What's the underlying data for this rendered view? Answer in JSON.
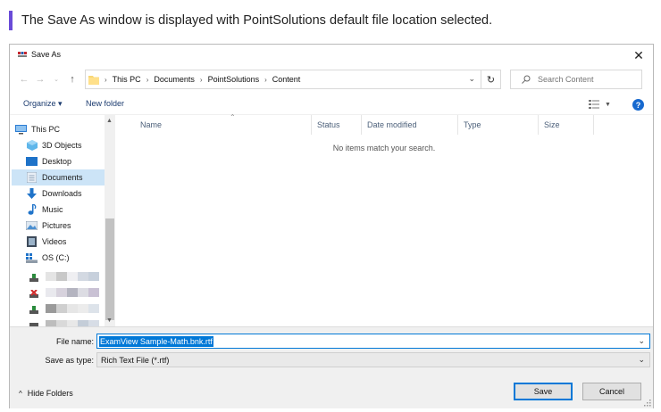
{
  "caption": "The Save As window is displayed with PointSolutions default file location selected.",
  "dialog": {
    "title": "Save As",
    "close": "✕"
  },
  "address": {
    "crumbs": [
      "This PC",
      "Documents",
      "PointSolutions",
      "Content"
    ],
    "separator": "›",
    "dropdown": "⌄",
    "refresh": "↻"
  },
  "search": {
    "placeholder": "Search Content"
  },
  "toolbar": {
    "organize": "Organize ▾",
    "new_folder": "New folder",
    "help": "?"
  },
  "nav": {
    "items": [
      {
        "label": "This PC",
        "icon": "pc-icon"
      },
      {
        "label": "3D Objects",
        "icon": "3d-objects-icon"
      },
      {
        "label": "Desktop",
        "icon": "desktop-icon"
      },
      {
        "label": "Documents",
        "icon": "documents-icon"
      },
      {
        "label": "Downloads",
        "icon": "downloads-icon"
      },
      {
        "label": "Music",
        "icon": "music-icon"
      },
      {
        "label": "Pictures",
        "icon": "pictures-icon"
      },
      {
        "label": "Videos",
        "icon": "videos-icon"
      },
      {
        "label": "OS (C:)",
        "icon": "drive-icon"
      }
    ],
    "selected": "Documents"
  },
  "columns": [
    "Name",
    "Status",
    "Date modified",
    "Type",
    "Size"
  ],
  "empty_message": "No items match your search.",
  "form": {
    "file_name_label": "File name:",
    "file_name_value": "ExamView Sample-Math.bnk.rtf",
    "save_type_label": "Save as type:",
    "save_type_value": "Rich Text File (*.rtf)"
  },
  "footer": {
    "hide_folders": "Hide Folders",
    "save": "Save",
    "cancel": "Cancel"
  },
  "colors": {
    "accent": "#0078d7",
    "caption_bar": "#6a4bd8",
    "selected_nav": "#cce4f7",
    "help": "#1769cf"
  }
}
